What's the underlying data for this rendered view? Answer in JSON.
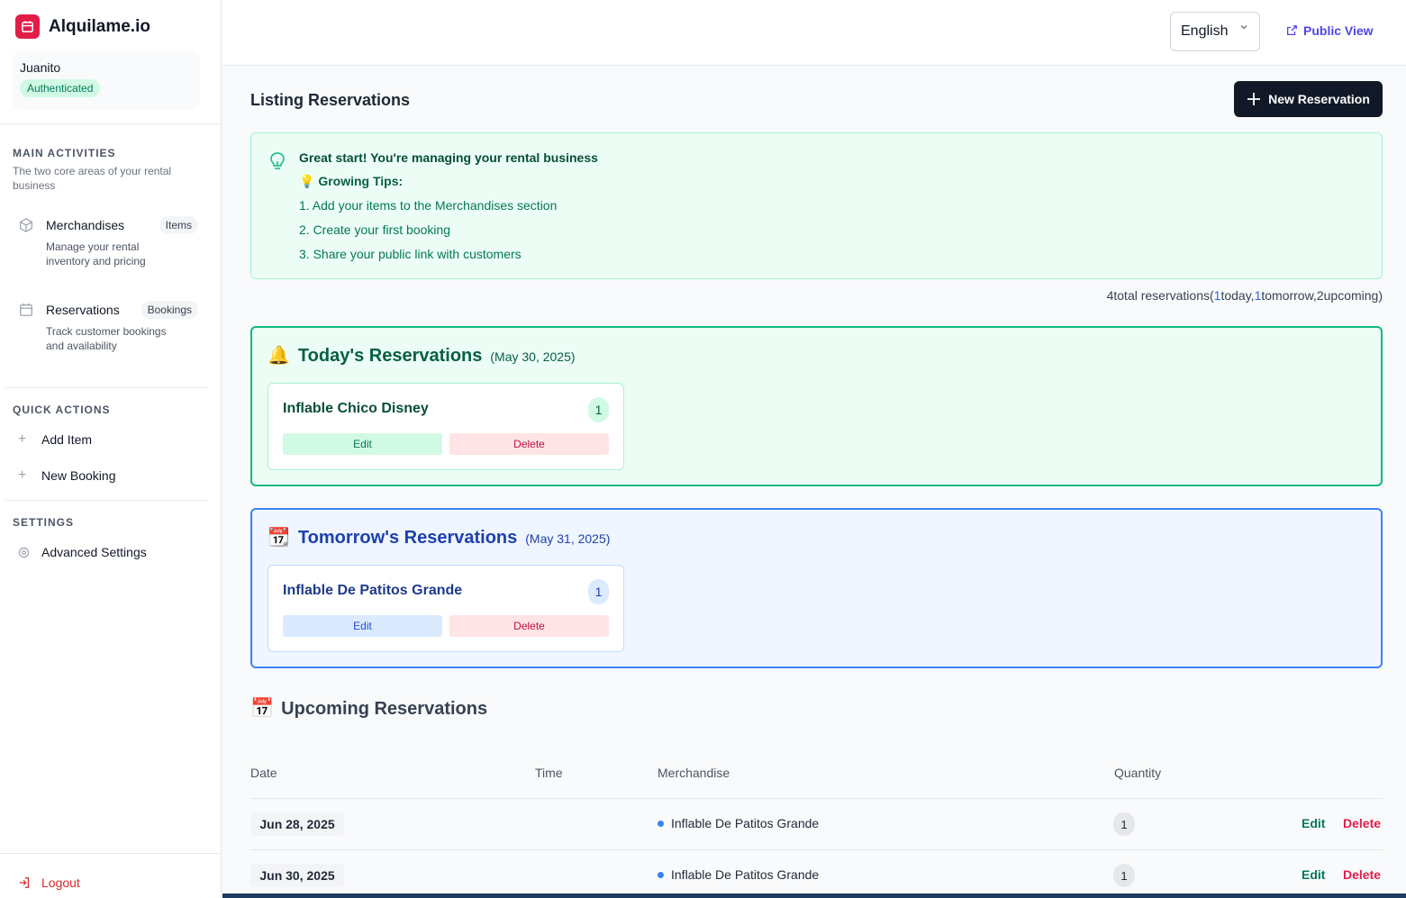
{
  "sidebar": {
    "app_name": "Alquilame.io",
    "user": {
      "name": "Juanito",
      "status": "Authenticated"
    },
    "main_activities": {
      "title": "MAIN ACTIVITIES",
      "subtitle": "The two core areas of your rental business",
      "items": [
        {
          "label": "Merchandises",
          "tag": "Items",
          "description": "Manage your rental inventory and pricing",
          "icon": "cube-icon"
        },
        {
          "label": "Reservations",
          "tag": "Bookings",
          "description": "Track customer bookings and availability",
          "icon": "calendar-icon"
        }
      ]
    },
    "quick_actions": {
      "title": "QUICK ACTIONS",
      "items": [
        {
          "label": "Add Item",
          "icon": "plus-icon"
        },
        {
          "label": "New Booking",
          "icon": "plus-icon"
        }
      ]
    },
    "settings": {
      "title": "SETTINGS",
      "items": [
        {
          "label": "Advanced Settings",
          "icon": "gear-icon"
        }
      ]
    },
    "logout_label": "Logout"
  },
  "header": {
    "language": "English",
    "public_view_label": "Public View"
  },
  "main": {
    "title": "Listing Reservations",
    "new_reservation_label": "New Reservation",
    "tips": {
      "heading": "Great start! You're managing your rental business",
      "subheading": "💡 Growing Tips:",
      "steps": [
        "1. Add your items to the Merchandises section",
        "2. Create your first booking",
        "3. Share your public link with customers"
      ]
    },
    "summary": {
      "total": "4",
      "total_label": "total reservations(",
      "today_count": "1",
      "today_label": "today,",
      "tomorrow_count": "1",
      "tomorrow_label": "tomorrow,",
      "upcoming_count": "2",
      "upcoming_label": "upcoming)"
    },
    "today": {
      "emoji": "🔔",
      "title": "Today's Reservations",
      "date": "(May 30, 2025)",
      "card": {
        "name": "Inflable Chico Disney",
        "quantity": "1",
        "edit_label": "Edit",
        "delete_label": "Delete"
      }
    },
    "tomorrow": {
      "emoji": "📆",
      "title": "Tomorrow's Reservations",
      "date": "(May 31, 2025)",
      "card": {
        "name": "Inflable De Patitos Grande",
        "quantity": "1",
        "edit_label": "Edit",
        "delete_label": "Delete"
      }
    },
    "upcoming": {
      "emoji": "📅",
      "title": "Upcoming Reservations",
      "columns": [
        "Date",
        "Time",
        "Merchandise",
        "Quantity"
      ],
      "rows": [
        {
          "date": "Jun 28, 2025",
          "time": "",
          "merchandise": "Inflable De Patitos Grande",
          "quantity": "1",
          "edit_label": "Edit",
          "delete_label": "Delete"
        },
        {
          "date": "Jun 30, 2025",
          "time": "",
          "merchandise": "Inflable De Patitos Grande",
          "quantity": "1",
          "edit_label": "Edit",
          "delete_label": "Delete"
        }
      ]
    }
  },
  "colors": {
    "brand": "#e11d48",
    "accent": "#4f46e5",
    "today": "#10b981",
    "tomorrow": "#3b82f6"
  }
}
